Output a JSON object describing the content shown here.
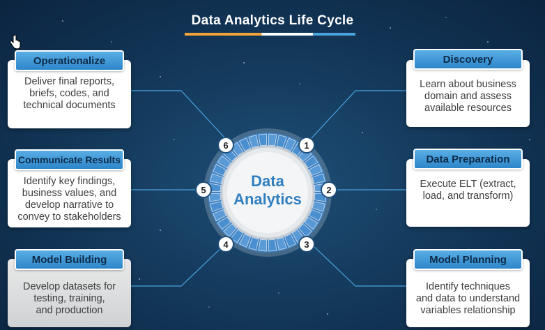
{
  "title": "Data Analytics Life Cycle",
  "center": {
    "line1": "Data",
    "line2": "Analytics"
  },
  "phases": [
    {
      "num": "1",
      "name": "Discovery",
      "lines": [
        "Learn about business",
        "domain and assess",
        "available resources"
      ]
    },
    {
      "num": "2",
      "name": "Data Preparation",
      "lines": [
        "Execute ELT (extract,",
        "load, and transform)"
      ]
    },
    {
      "num": "3",
      "name": "Model Planning",
      "lines": [
        "Identify techniques",
        "and data to understand",
        "variables relationship"
      ]
    },
    {
      "num": "4",
      "name": "Model Building",
      "lines": [
        "Develop datasets for",
        "testing, training,",
        "and production"
      ]
    },
    {
      "num": "5",
      "name": "Communicate Results",
      "lines": [
        "Identify key findings,",
        "business values, and",
        "develop narrative to",
        "convey to stakeholders"
      ]
    },
    {
      "num": "6",
      "name": "Operationalize",
      "lines": [
        "Deliver final reports,",
        "briefs, codes, and",
        "technical documents"
      ]
    }
  ],
  "colors": {
    "accent_blue": "#2d86c9",
    "title_orange": "#f2a33a",
    "ring_blue": "#4a8fd0",
    "text_blue": "#2f7fc0"
  },
  "icons": {
    "cursor": "hand-pointer-icon"
  }
}
